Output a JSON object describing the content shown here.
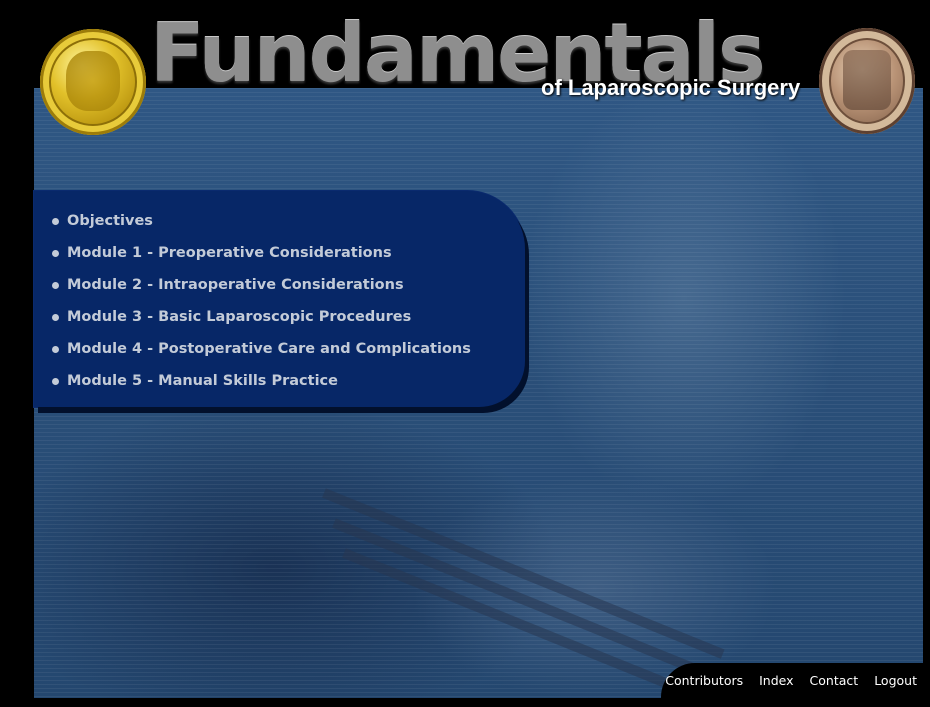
{
  "header": {
    "title": "Fundamentals",
    "subtitle": "of Laparoscopic Surgery"
  },
  "menu": {
    "items": [
      {
        "label": "Objectives"
      },
      {
        "label": "Module 1 - Preoperative Considerations"
      },
      {
        "label": "Module 2 - Intraoperative Considerations"
      },
      {
        "label": "Module 3 - Basic Laparoscopic Procedures"
      },
      {
        "label": "Module 4 - Postoperative Care and Complications"
      },
      {
        "label": "Module 5 - Manual Skills Practice"
      }
    ]
  },
  "footer": {
    "links": [
      {
        "label": "Contributors"
      },
      {
        "label": "Index"
      },
      {
        "label": "Contact"
      },
      {
        "label": "Logout"
      }
    ]
  },
  "colors": {
    "background": "#000000",
    "panel_blue": "#2a4f79",
    "menu_navy": "#072767",
    "menu_text": "#c3cbd8",
    "title_gray": "#8e8e8e",
    "seal_gold": "#d9b420",
    "seal_bronze": "#b99376"
  },
  "icons": {
    "left_seal": "gold-seal-icon",
    "right_seal": "college-seal-icon"
  }
}
